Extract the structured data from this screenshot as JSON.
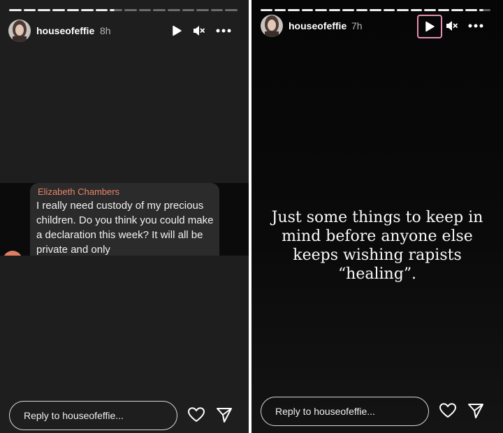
{
  "left_story": {
    "username": "houseofeffie",
    "time": "8h",
    "progress": {
      "segments": 16,
      "completed": 7,
      "current_fraction": 0.35
    },
    "quoted_message": {
      "sender": "Elizabeth Chambers",
      "text": "I really need custody of my precious children. Do you think you could make a declaration this week? It will all be private and only"
    },
    "reply_placeholder": "Reply to houseofeffie...",
    "icons": [
      "play-icon",
      "mute-icon",
      "more-icon",
      "heart-icon",
      "send-icon"
    ]
  },
  "right_story": {
    "username": "houseofeffie",
    "time": "7h",
    "progress": {
      "segments": 17,
      "completed": 16,
      "current_fraction": 0.5
    },
    "text": "Just some things to keep in mind before anyone else keeps wishing rapists “healing”.",
    "reply_placeholder": "Reply to houseofeffie...",
    "icons": [
      "play-icon",
      "mute-icon",
      "more-icon",
      "heart-icon",
      "send-icon"
    ]
  },
  "colors": {
    "left_background": "#1e1e1e",
    "right_background": "#080808",
    "sender_name": "#e8856b",
    "play_highlight": "#e48fb2",
    "bubble": "#2b2b2b"
  }
}
